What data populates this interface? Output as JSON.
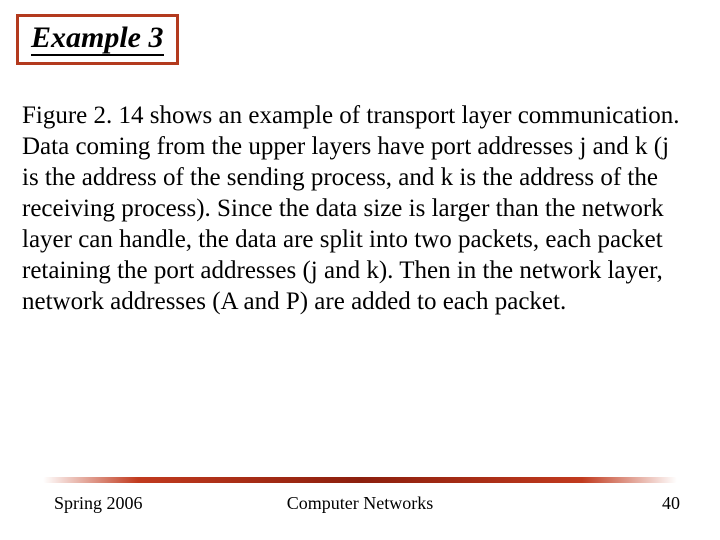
{
  "title": "Example 3",
  "body": "Figure 2. 14 shows an example of transport layer communication. Data coming from the upper layers have port addresses j and k (j is the address of the sending process, and k is the address of the receiving process). Since the data size is larger than the network layer can handle, the data are split into two packets, each packet retaining the port addresses (j and k). Then in the network layer, network addresses (A and P) are added to each packet.",
  "footer": {
    "left": "Spring 2006",
    "center": "Computer Networks",
    "right": "40"
  }
}
